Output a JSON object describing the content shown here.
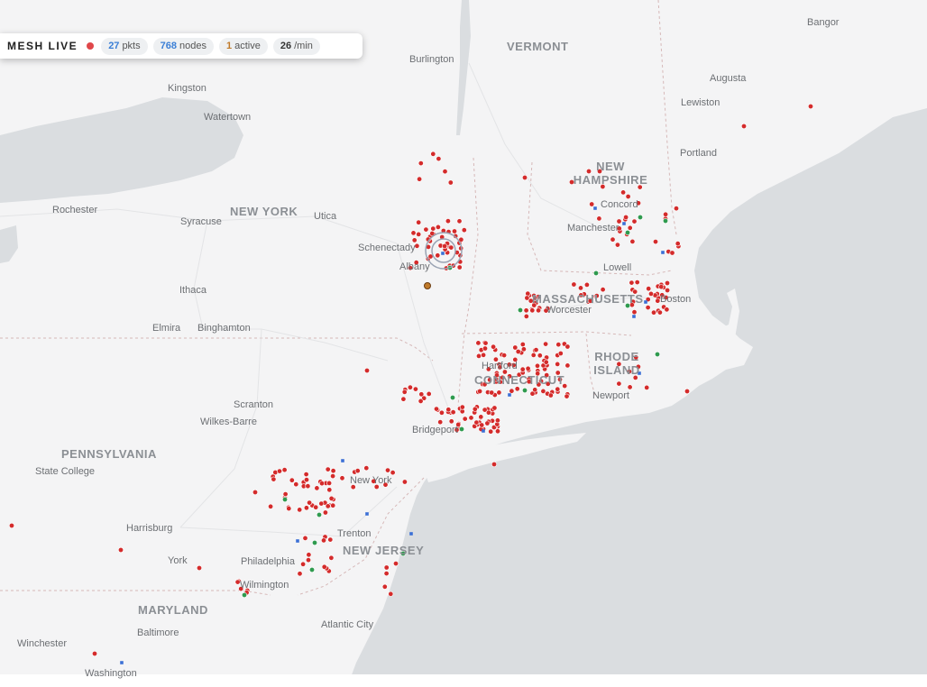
{
  "hud": {
    "title": "MESH LIVE",
    "packets_value": "27",
    "packets_unit": "pkts",
    "nodes_value": "768",
    "nodes_unit": "nodes",
    "active_value": "1",
    "active_unit": "active",
    "rate_value": "26",
    "rate_unit": "/min",
    "live_color": "#e0474a"
  },
  "map": {
    "water_color": "#d9dcdf",
    "land_color": "#f4f4f5",
    "node_color": "#d42b2b",
    "active_node_color": "#2e9a4e",
    "repeater_color": "#3b6fd6",
    "states": [
      "VERMONT",
      "NEW HAMPSHIRE",
      "NEW YORK",
      "MASSACHUSETTS",
      "RHODE ISLAND",
      "CONNECTICUT",
      "PENNSYLVANIA",
      "NEW JERSEY",
      "MARYLAND"
    ],
    "cities": [
      "Bangor",
      "Burlington",
      "Augusta",
      "Kingston",
      "Lewiston",
      "Watertown",
      "Portland",
      "Concord",
      "Manchester",
      "Rochester",
      "Syracuse",
      "Utica",
      "Schenectady",
      "Albany",
      "Lowell",
      "Boston",
      "Ithaca",
      "Worcester",
      "Elmira",
      "Binghamton",
      "Hartford",
      "Newport",
      "Scranton",
      "Wilkes-Barre",
      "Bridgeport",
      "State College",
      "New York",
      "Harrisburg",
      "Trenton",
      "York",
      "Philadelphia",
      "Wilmington",
      "Atlantic City",
      "Baltimore",
      "Winchester",
      "Washington"
    ]
  }
}
